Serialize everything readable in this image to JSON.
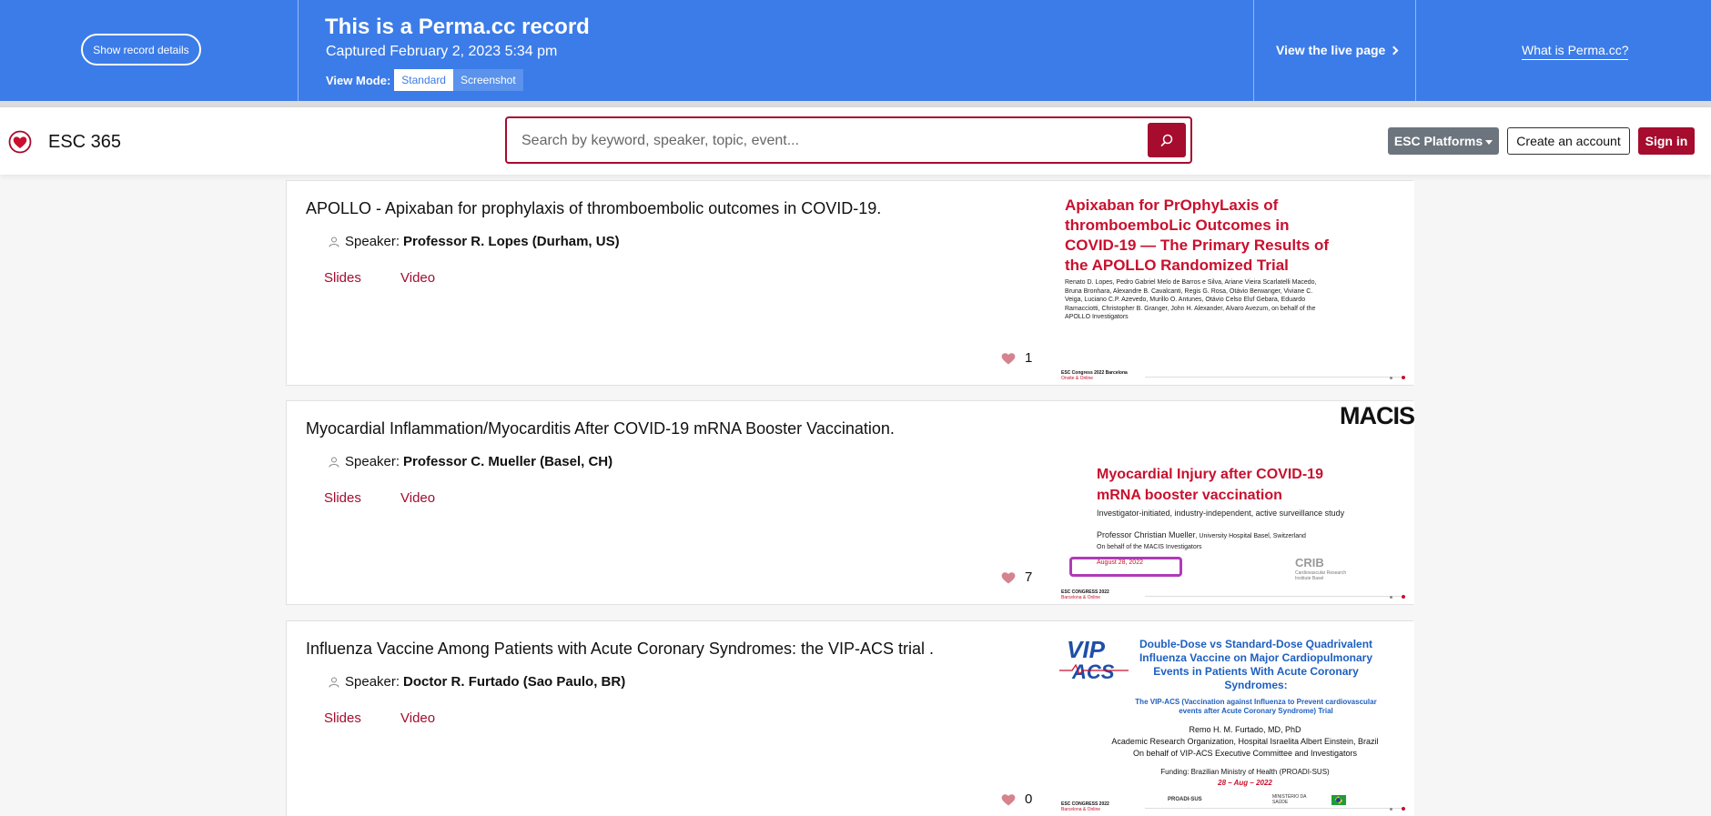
{
  "perma": {
    "show_details": "Show record details",
    "title": "This is a Perma.cc record",
    "captured": "Captured February 2, 2023 5:34 pm",
    "view_mode_label": "View Mode:",
    "view_modes": [
      "Standard",
      "Screenshot"
    ],
    "live_link": "View the live page",
    "what_is": "What is Perma.cc?"
  },
  "header": {
    "brand": "ESC 365",
    "search_placeholder": "Search by keyword, speaker, topic, event...",
    "platforms": "ESC Platforms",
    "create_account": "Create an account",
    "sign_in": "Sign in"
  },
  "colors": {
    "perma_blue": "#3c7ce8",
    "esc_red": "#a50c2e",
    "platforms_gray": "#6c757d"
  },
  "cards": [
    {
      "title": "APOLLO - Apixaban for prophylaxis of thromboembolic outcomes in COVID-19.",
      "speaker_label": "Speaker:",
      "speaker": "Professor R. Lopes (Durham, US)",
      "slides": "Slides",
      "video": "Video",
      "likes": "1",
      "thumb": {
        "title": "Apixaban for PrOphyLaxis of thromboemboLic Outcomes in COVID-19 — The Primary Results of the APOLLO Randomized Trial",
        "authors": "Renato D. Lopes, Pedro Gabriel Melo de Barros e Silva, Ariane Vieira Scarlatelli Macedo, Bruna Bronhara, Alexandre B. Cavalcanti, Regis G. Rosa, Otávio Berwanger, Viviane C. Veiga, Luciano C.P. Azevedo, Murillo O. Antunes, Otávio Celso Eluf Gebara, Eduardo Ramacciotti, Christopher B. Granger, John H. Alexander, Alvaro Avezum, on behalf of the APOLLO Investigators",
        "footer": "ESC Congress 2022 Barcelona",
        "footer_sub": "Onsite & Online"
      }
    },
    {
      "title": "Myocardial Inflammation/Myocarditis After COVID-19 mRNA Booster Vaccination.",
      "speaker_label": "Speaker:",
      "speaker": "Professor C. Mueller (Basel, CH)",
      "slides": "Slides",
      "video": "Video",
      "likes": "7",
      "thumb": {
        "logo": "MACIS",
        "title": "Myocardial Injury after COVID-19 mRNA booster vaccination",
        "subtitle": "Investigator-initiated, industry-independent, active surveillance study",
        "presenter": "Professor Christian Mueller",
        "presenter_affil": ", University Hospital Basel, Switzerland",
        "behalf": "On behalf of the MACIS Investigators",
        "date": "August 28, 2022",
        "crib": "CRIB",
        "crib_sub": "Cardiovascular Research Institute Basel",
        "footer": "ESC CONGRESS 2022",
        "footer_sub": "Barcelona & Online"
      }
    },
    {
      "title": "Influenza Vaccine Among Patients with Acute Coronary Syndromes: the VIP-ACS trial .",
      "speaker_label": "Speaker:",
      "speaker": "Doctor R. Furtado (Sao Paulo, BR)",
      "slides": "Slides",
      "video": "Video",
      "likes": "0",
      "thumb": {
        "logo_top": "VIP",
        "logo_bottom": "ACS",
        "title": "Double-Dose vs Standard-Dose Quadrivalent Influenza Vaccine on Major Cardiopulmonary Events in Patients With Acute Coronary Syndromes:",
        "subtitle": "The VIP-ACS (Vaccination against Influenza to Prevent cardiovascular events after Acute Coronary Syndrome) Trial",
        "presenter": "Remo H. M. Furtado, MD, PhD",
        "affil": "Academic Research Organization, Hospital Israelita Albert Einstein, Brazil",
        "behalf": "On behalf of VIP-ACS Executive Committee and Investigators",
        "funding": "Funding: Brazilian Ministry of Health (PROADI-SUS)",
        "date": "28 – Aug – 2022",
        "sponsor": "PROADI-SUS",
        "ministry": "MINISTÉRIO DA SAÚDE",
        "footer": "ESC CONGRESS 2022",
        "footer_sub": "Barcelona & Online"
      }
    }
  ]
}
